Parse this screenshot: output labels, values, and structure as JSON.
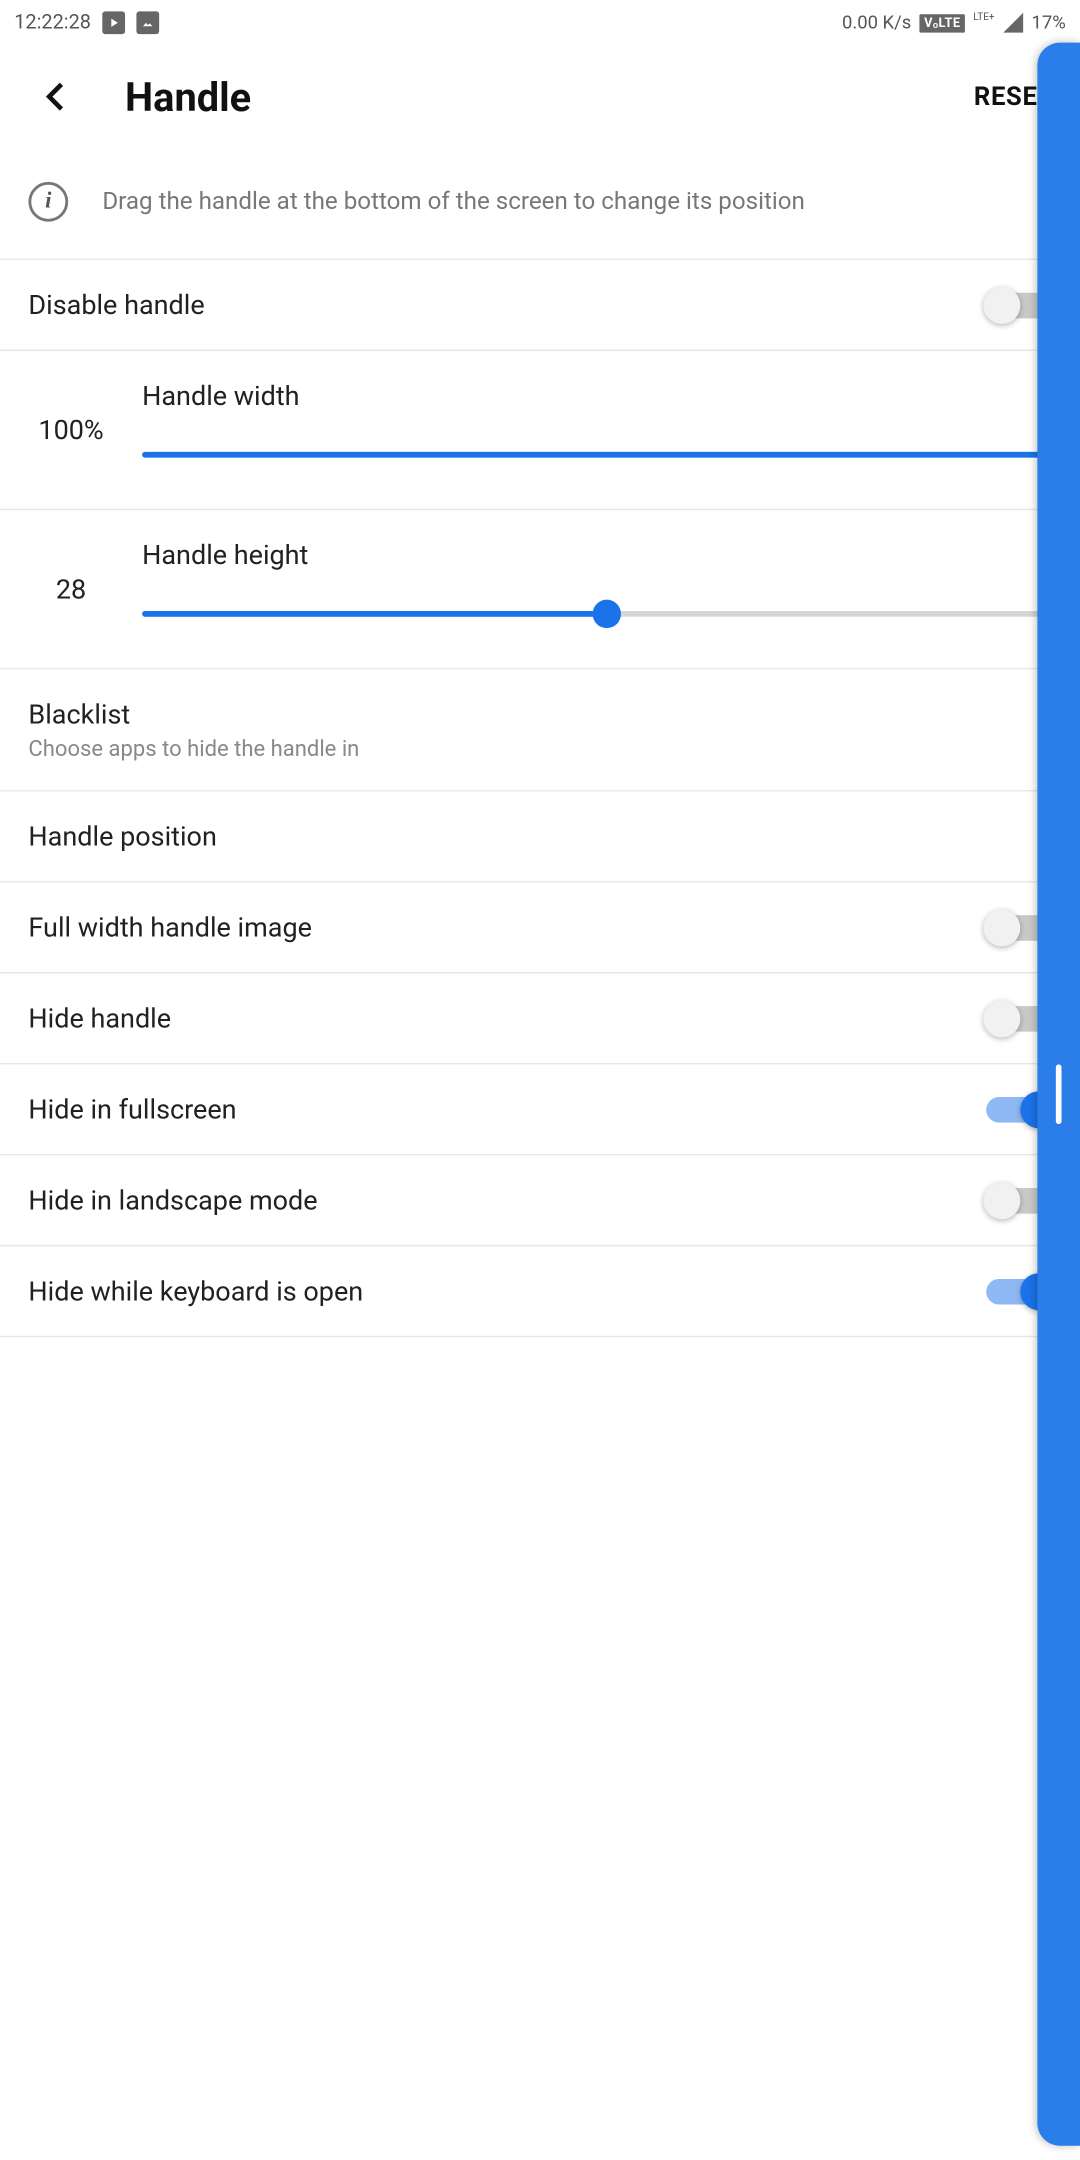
{
  "status": {
    "time": "12:22:28",
    "kbps": "0.00 K/s",
    "volte": "VₒLTE",
    "lte": "LTE+",
    "battery": "17%"
  },
  "header": {
    "title": "Handle",
    "reset": "RESET"
  },
  "info": "Drag the handle at the bottom of the screen to change its position",
  "rows": {
    "disable_handle": "Disable handle",
    "handle_width_label": "Handle width",
    "handle_width_value": "100%",
    "handle_width_pct": 100,
    "handle_height_label": "Handle height",
    "handle_height_value": "28",
    "handle_height_pct": 50,
    "blacklist": "Blacklist",
    "blacklist_sub": "Choose apps to hide the handle in",
    "handle_position": "Handle position",
    "full_width_image": "Full width handle image",
    "hide_handle": "Hide handle",
    "hide_fullscreen": "Hide in fullscreen",
    "hide_landscape": "Hide in landscape mode",
    "hide_keyboard": "Hide while keyboard is open"
  },
  "toggles": {
    "disable_handle": false,
    "full_width_image": false,
    "hide_handle": false,
    "hide_fullscreen": true,
    "hide_landscape": false,
    "hide_keyboard": true
  }
}
